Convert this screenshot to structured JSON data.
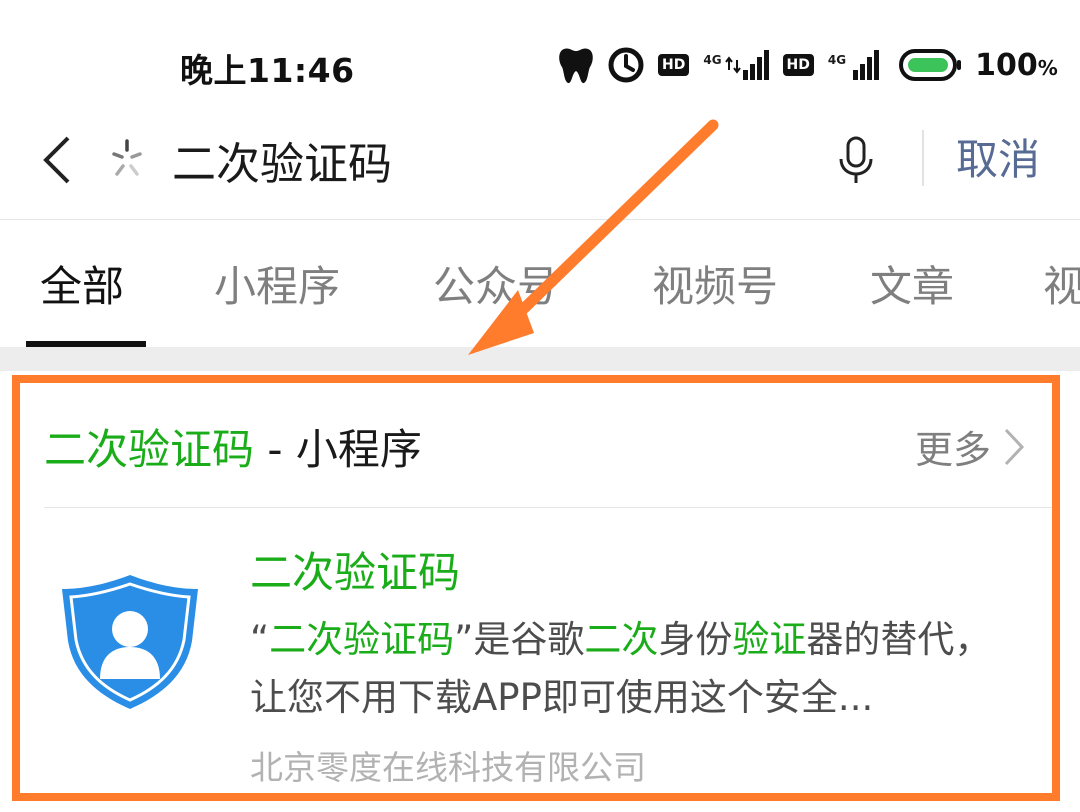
{
  "status_bar": {
    "time": "晚上11:46",
    "hd_label_1": "HD",
    "hd_label_2": "HD",
    "network_label_1": "4G",
    "network_label_2": "4G",
    "battery_percent": "100",
    "battery_unit": "%",
    "battery_level": 1.0,
    "icons": [
      "tooth-icon",
      "clock-icon",
      "signal-icon",
      "battery-icon"
    ]
  },
  "search": {
    "query": "二次验证码",
    "cancel_label": "取消"
  },
  "tabs": [
    {
      "label": "全部",
      "active": true
    },
    {
      "label": "小程序",
      "active": false
    },
    {
      "label": "公众号",
      "active": false
    },
    {
      "label": "视频号",
      "active": false
    },
    {
      "label": "文章",
      "active": false
    },
    {
      "label": "视",
      "active": false
    }
  ],
  "result_section": {
    "header_highlight": "二次验证码",
    "header_suffix": " - 小程序",
    "more_label": "更多",
    "item": {
      "title": "二次验证码",
      "desc_parts": [
        {
          "text": "“",
          "hl": false
        },
        {
          "text": "二次验证码",
          "hl": true
        },
        {
          "text": "”是谷歌",
          "hl": false
        },
        {
          "text": "二次",
          "hl": true
        },
        {
          "text": "身份",
          "hl": false
        },
        {
          "text": "验证",
          "hl": true
        },
        {
          "text": "器的替代，让您不用下载APP即可使用这个安全...",
          "hl": false
        }
      ],
      "company": "北京零度在线科技有限公司"
    }
  },
  "colors": {
    "highlight_green": "#1aad19",
    "cancel_blue": "#576b95",
    "annotation_orange": "#fe7c2c",
    "icon_blue": "#2b8ee6"
  }
}
